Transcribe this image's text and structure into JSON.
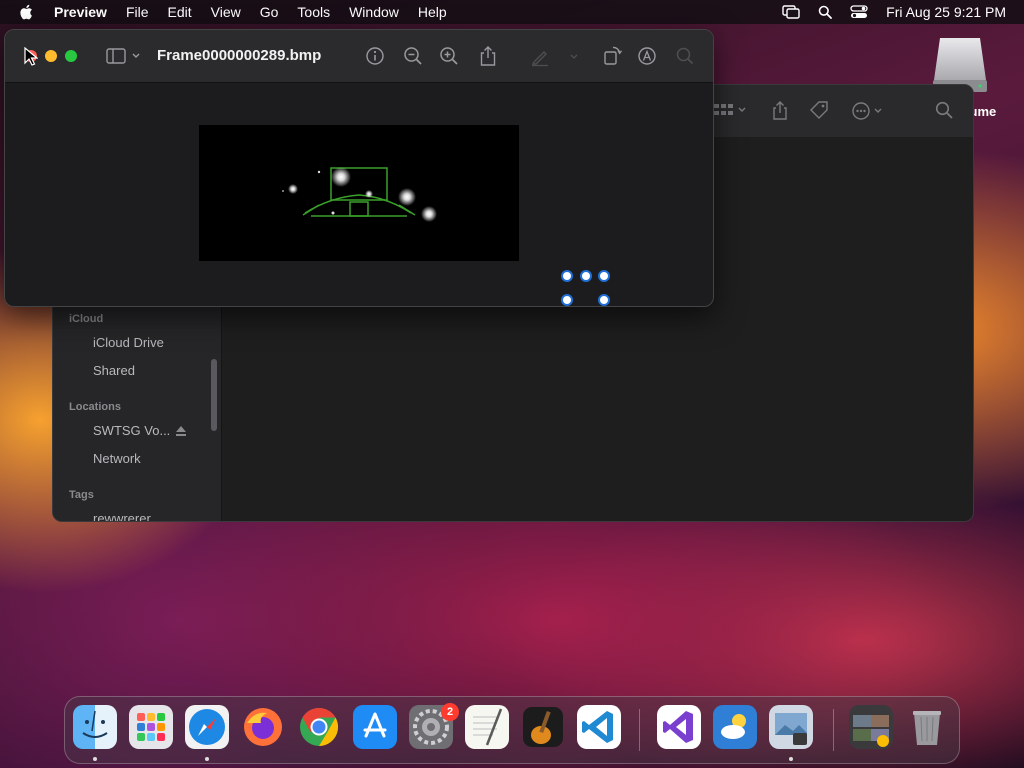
{
  "menubar": {
    "app_name": "Preview",
    "menus": [
      "File",
      "Edit",
      "View",
      "Go",
      "Tools",
      "Window",
      "Help"
    ],
    "clock": "Fri Aug 25  9:21 PM"
  },
  "desktop": {
    "drive_label": "olume"
  },
  "finder": {
    "sidebar": {
      "icloud_header": "iCloud",
      "icloud_items": [
        "iCloud Drive",
        "Shared"
      ],
      "locations_header": "Locations",
      "location_items": [
        "SWTSG Vo...",
        "Network"
      ],
      "tags_header": "Tags",
      "tag_items": [
        "rewwrerer"
      ]
    }
  },
  "preview": {
    "title": "Frame0000000289.bmp"
  },
  "dock": {
    "apps": [
      {
        "name": "Finder",
        "icon": "finder-icon",
        "color": "#2d8cf0"
      },
      {
        "name": "Launchpad",
        "icon": "launchpad-icon",
        "color": "#e8e8ec"
      },
      {
        "name": "Safari",
        "icon": "safari-icon",
        "color": "#1e88e5"
      },
      {
        "name": "Firefox",
        "icon": "firefox-icon",
        "color": "#ff7139"
      },
      {
        "name": "Chrome",
        "icon": "chrome-icon",
        "color": "#ffffff"
      },
      {
        "name": "App Store",
        "icon": "app-store-icon",
        "color": "#1f8cf5"
      },
      {
        "name": "System Settings",
        "icon": "system-settings-icon",
        "color": "#8e8e93",
        "badge": "2"
      },
      {
        "name": "TextEdit",
        "icon": "textedit-icon",
        "color": "#f5f5f0"
      },
      {
        "name": "GarageBand",
        "icon": "garageband-icon",
        "color": "#2a2a2a"
      },
      {
        "name": "Visual Studio Code",
        "icon": "vscode-icon",
        "color": "#ffffff"
      },
      {
        "name": "Visual Studio",
        "icon": "visual-studio-icon",
        "color": "#ffffff"
      },
      {
        "name": "Weather",
        "icon": "weather-icon",
        "color": "#2f7fd6"
      },
      {
        "name": "Preview",
        "icon": "preview-icon",
        "color": "#cfd8e3"
      },
      {
        "name": "Photos Folder",
        "icon": "stack-icon",
        "color": "#444444"
      },
      {
        "name": "Trash",
        "icon": "trash-icon",
        "color": "#9a9a9e"
      }
    ]
  }
}
